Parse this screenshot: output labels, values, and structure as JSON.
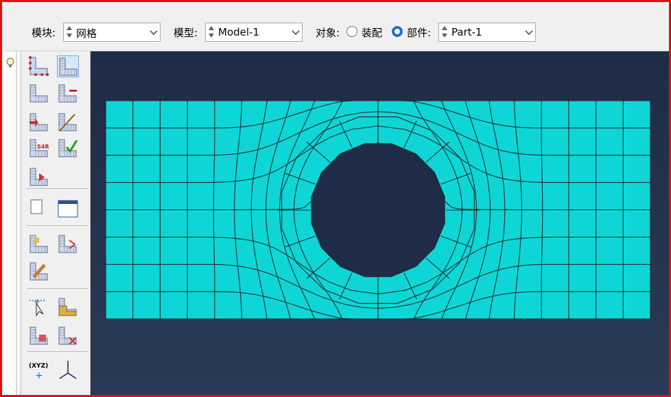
{
  "toolbar": {
    "module_label": "模块:",
    "module_value": "网格",
    "model_label": "模型:",
    "model_value": "Model-1",
    "object_label": "对象:",
    "assembly_label": "装配",
    "part_label": "部件:",
    "part_value": "Part-1",
    "object_selected": "part"
  },
  "palette": {
    "tools": [
      "seed-part-icon",
      "seed-edges-icon",
      "mesh-part-icon",
      "mesh-region-icon",
      "delete-mesh-icon",
      "partition-icon",
      "element-type-icon",
      "verify-mesh-icon",
      "mesh-controls-icon",
      "query-mesh-icon",
      "mesh-stats-icon",
      "edit-mesh-icon",
      "remesh-icon",
      "virtual-topology-icon",
      "select-node-icon",
      "create-part-icon",
      "combine-icon",
      "split-icon",
      "datum-point-icon",
      "datum-axis-icon"
    ],
    "xyz_text": "(XYZ)"
  },
  "viewport": {
    "background": "#1f2c47",
    "mesh_fill": "#0fd6d6",
    "mesh_line": "#1a2a2a"
  }
}
